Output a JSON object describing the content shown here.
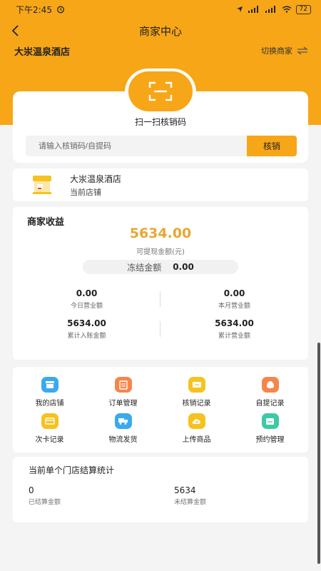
{
  "status_bar": {
    "time": "下午2:45",
    "battery": "72"
  },
  "nav": {
    "title": "商家中心"
  },
  "merchant": {
    "name": "大汖温泉酒店",
    "switch_label": "切换商家"
  },
  "scan": {
    "label": "扫一扫核销码",
    "input_placeholder": "请输入核销码/自提码",
    "verify_button": "核销"
  },
  "current_store": {
    "name": "大汖温泉酒店",
    "subtitle": "当前店铺"
  },
  "earnings": {
    "title": "商家收益",
    "withdrawable_amount": "5634.00",
    "withdrawable_label": "可提现金额(元)",
    "frozen_label": "冻结金额",
    "frozen_value": "0.00",
    "stats": [
      {
        "value": "0.00",
        "label": "今日营业额"
      },
      {
        "value": "0.00",
        "label": "本月营业额"
      },
      {
        "value": "5634.00",
        "label": "累计入账金额"
      },
      {
        "value": "5634.00",
        "label": "累计营业额"
      }
    ]
  },
  "menu": [
    {
      "label": "我的店铺",
      "icon": "store-icon",
      "color": "#3aa9f0"
    },
    {
      "label": "订单管理",
      "icon": "order-icon",
      "color": "#f5864a"
    },
    {
      "label": "核销记录",
      "icon": "ticket-icon",
      "color": "#f7c21f"
    },
    {
      "label": "自提记录",
      "icon": "bag-icon",
      "color": "#f5864a"
    },
    {
      "label": "次卡记录",
      "icon": "card-icon",
      "color": "#f7c21f"
    },
    {
      "label": "物流发货",
      "icon": "truck-icon",
      "color": "#3aa9f0"
    },
    {
      "label": "上传商品",
      "icon": "upload-icon",
      "color": "#f7c21f"
    },
    {
      "label": "预约管理",
      "icon": "calendar-icon",
      "color": "#3cc9a6"
    }
  ],
  "settlement": {
    "title": "当前单个门店结算统计",
    "settled_value": "0",
    "settled_label": "已结算金额",
    "unsettled_value": "5634",
    "unsettled_label": "未结算金额"
  },
  "colors": {
    "brand": "#f7a617",
    "amount": "#e8a634"
  }
}
